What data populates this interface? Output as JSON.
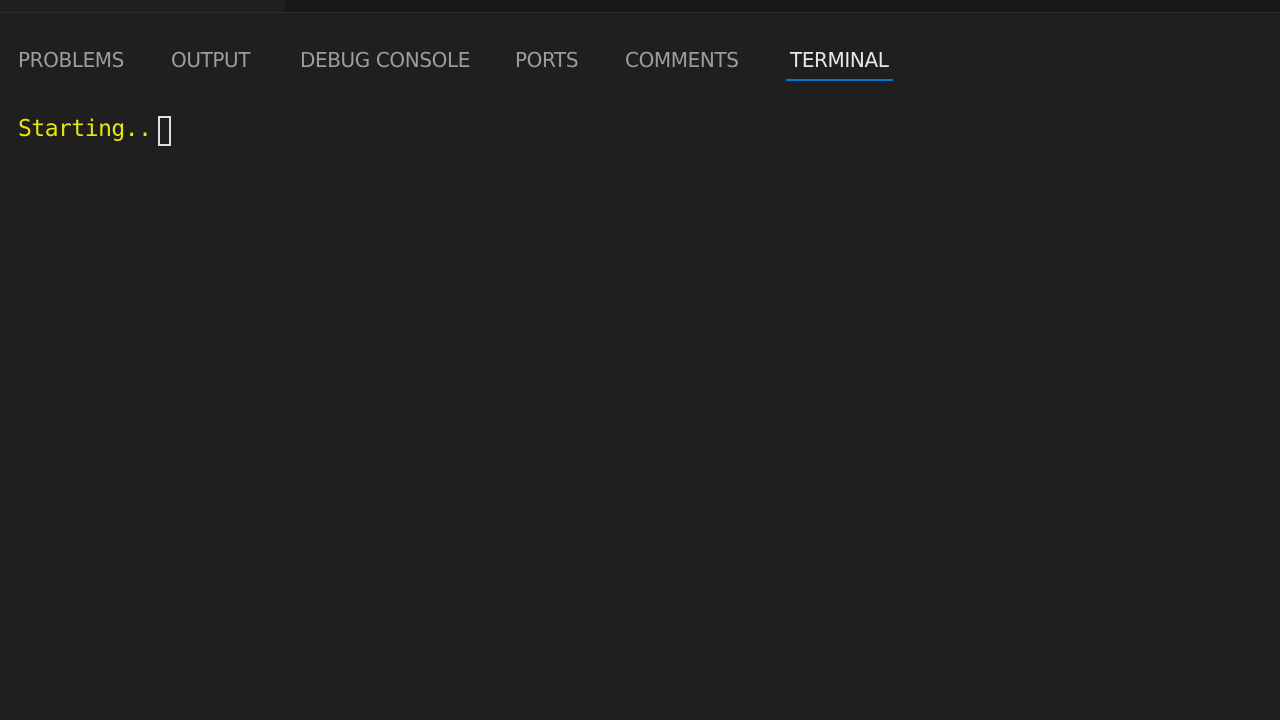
{
  "panel": {
    "tabs": [
      {
        "label": "PROBLEMS",
        "active": false
      },
      {
        "label": "OUTPUT",
        "active": false
      },
      {
        "label": "DEBUG CONSOLE",
        "active": false
      },
      {
        "label": "PORTS",
        "active": false
      },
      {
        "label": "COMMENTS",
        "active": false
      },
      {
        "label": "TERMINAL",
        "active": true
      }
    ]
  },
  "terminal": {
    "line": "Starting.."
  },
  "colors": {
    "background": "#1f1f1f",
    "tab_inactive": "#9d9d9d",
    "tab_active": "#e7e7e7",
    "tab_indicator": "#0078d4",
    "terminal_text": "#e5e510",
    "cursor": "#e0e0e0"
  }
}
